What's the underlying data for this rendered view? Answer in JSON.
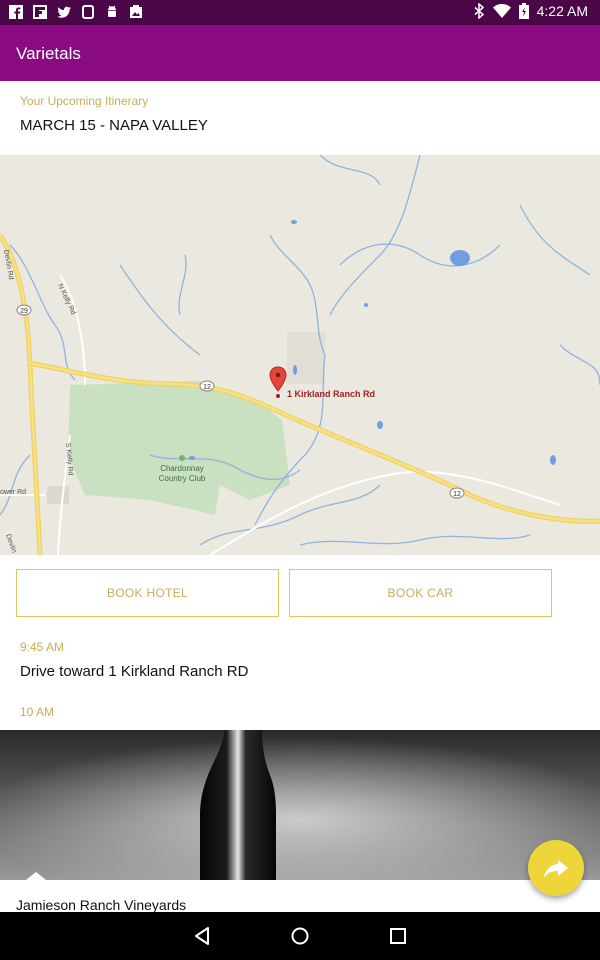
{
  "status_bar": {
    "time": "4:22 AM",
    "left_icons": [
      "facebook-icon",
      "flipboard-icon",
      "twitter-icon",
      "device-icon",
      "android-icon",
      "photo-icon"
    ],
    "right_icons": [
      "bluetooth-icon",
      "wifi-icon",
      "battery-icon"
    ]
  },
  "app_bar": {
    "title": "Varietals",
    "color": "#8a0a83"
  },
  "itinerary": {
    "label": "Your Upcoming Itinerary",
    "title": "MARCH 15 - NAPA VALLEY"
  },
  "map": {
    "marker_label": "1 Kirkland Ranch Rd",
    "place_labels": [
      "Chardonnay",
      "Country Club"
    ],
    "road_labels": [
      "Devlin Rd",
      "N Kelly Rd",
      "S Kelly Rd",
      "ower Rd",
      "Devlin"
    ],
    "route_shields": [
      "29",
      "12",
      "12"
    ]
  },
  "actions": {
    "book_hotel": "BOOK HOTEL",
    "book_car": "BOOK CAR"
  },
  "schedule": [
    {
      "time": "9:45 AM",
      "description": "Drive toward 1 Kirkland Ranch RD"
    },
    {
      "time": "10 AM"
    }
  ],
  "card": {
    "title": "Jamieson Ranch Vineyards"
  },
  "fab": {
    "icon": "share-icon",
    "color": "#eed63a"
  },
  "nav_bar": {
    "icons": [
      "back-icon",
      "home-icon",
      "recents-icon"
    ]
  }
}
